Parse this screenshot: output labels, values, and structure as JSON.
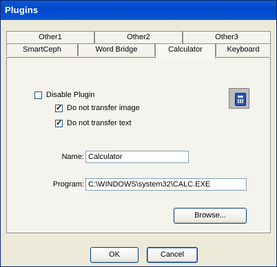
{
  "window": {
    "title": "Plugins"
  },
  "tabs": {
    "row1": [
      "Other1",
      "Other2",
      "Other3"
    ],
    "row2": [
      "SmartCeph",
      "Word Bridge",
      "Calculator",
      "Keyboard"
    ],
    "active": "Calculator"
  },
  "panel": {
    "disable_plugin": {
      "label": "Disable Plugin",
      "checked": false
    },
    "no_transfer_image": {
      "label": "Do not transfer image",
      "checked": true
    },
    "no_transfer_text": {
      "label": "Do not transfer text",
      "checked": true
    },
    "plugin_icon": "calculator-icon",
    "name": {
      "label": "Name:",
      "value": "Calculator"
    },
    "program": {
      "label": "Program:",
      "value": "C:\\WINDOWS\\system32\\CALC.EXE"
    },
    "browse_label": "Browse..."
  },
  "buttons": {
    "ok": "OK",
    "cancel": "Cancel"
  }
}
